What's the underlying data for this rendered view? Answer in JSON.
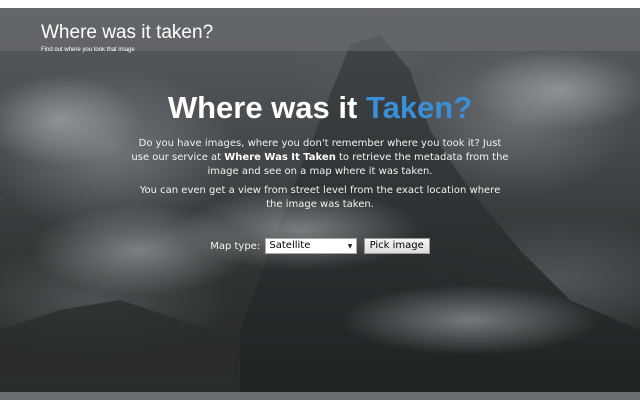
{
  "header": {
    "title": "Where was it taken?",
    "subtitle": "Find out where you took that image"
  },
  "hero": {
    "title_prefix": "Where was it ",
    "title_accent": "Taken?",
    "accent_color": "#3a8fd9",
    "intro_before": "Do you have images, where you don't remember where you took it? Just use our service at ",
    "intro_brand": "Where Was It Taken",
    "intro_after": " to retrieve the metadata from the image and see on a map where it was taken.",
    "intro_second": "You can even get a view from street level from the exact location where the image was taken."
  },
  "controls": {
    "map_type_label": "Map type:",
    "map_type_value": "Satellite",
    "pick_button": "Pick image"
  },
  "icons": {
    "select_arrow": "dropdown-arrow-icon"
  }
}
